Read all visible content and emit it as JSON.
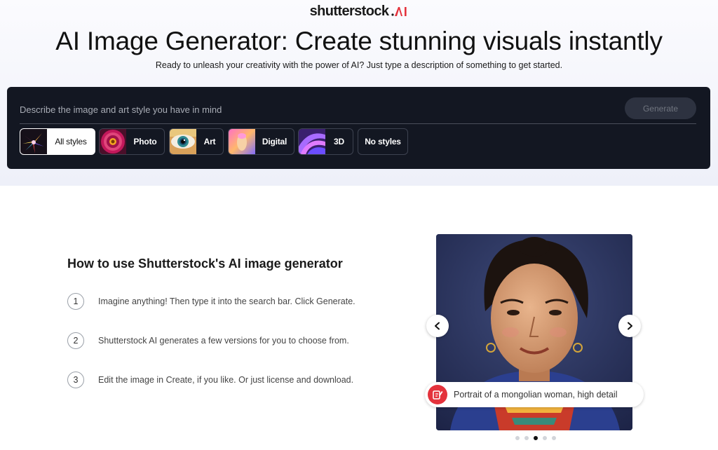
{
  "brand": {
    "logo_text": "shutterstock",
    "accent_color": "#e4323c"
  },
  "hero": {
    "headline": "AI Image Generator: Create stunning visuals instantly",
    "subline": "Ready to unleash your creativity with the power of AI? Just type a description of something to get started."
  },
  "generator": {
    "placeholder": "Describe the image and art style you have in mind",
    "generate_label": "Generate",
    "styles": [
      {
        "label": "All styles",
        "active": true
      },
      {
        "label": "Photo",
        "active": false
      },
      {
        "label": "Art",
        "active": false
      },
      {
        "label": "Digital",
        "active": false
      },
      {
        "label": "3D",
        "active": false
      },
      {
        "label": "No styles",
        "active": false
      }
    ]
  },
  "howto": {
    "title": "How to use Shutterstock's AI image generator",
    "steps": [
      {
        "num": "1",
        "text": "Imagine anything! Then type it into the search bar. Click Generate."
      },
      {
        "num": "2",
        "text": "Shutterstock AI generates a few versions for you to choose from."
      },
      {
        "num": "3",
        "text": "Edit the image in Create, if you like. Or just license and download."
      }
    ]
  },
  "carousel": {
    "caption": "Portrait of a mongolian woman, high detail",
    "prev_icon": "chevron-left-icon",
    "next_icon": "chevron-right-icon",
    "slide_count": 5,
    "active_index": 2
  }
}
